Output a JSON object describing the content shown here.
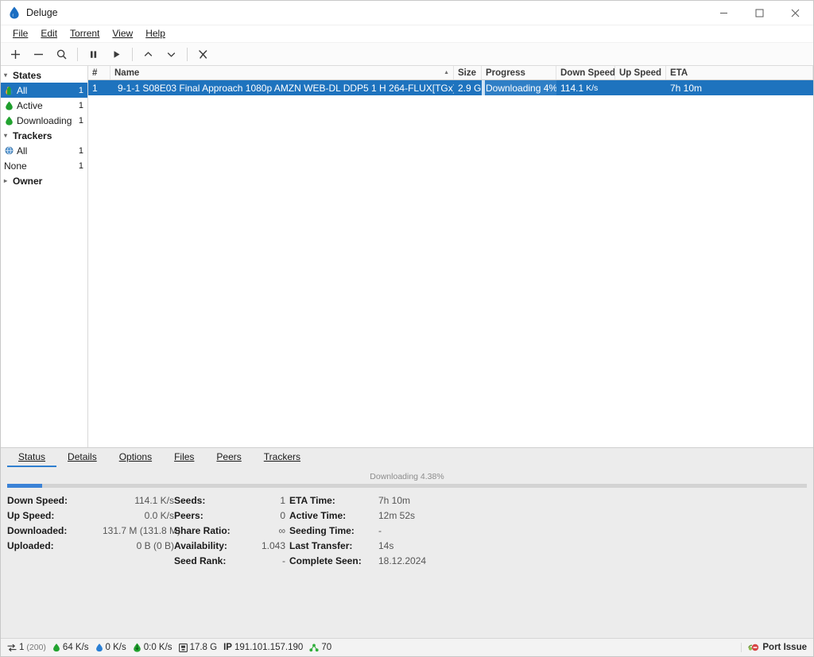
{
  "window": {
    "title": "Deluge",
    "icon": "deluge-droplet-icon",
    "minimize": "—",
    "maximize": "☐",
    "close": "✕"
  },
  "menubar": [
    {
      "label": "File",
      "accel": "F"
    },
    {
      "label": "Edit",
      "accel": "E"
    },
    {
      "label": "Torrent",
      "accel": "T"
    },
    {
      "label": "View",
      "accel": "V"
    },
    {
      "label": "Help",
      "accel": "H"
    }
  ],
  "toolbar": [
    {
      "name": "add-torrent-button",
      "icon": "plus-icon"
    },
    {
      "name": "remove-torrent-button",
      "icon": "minus-icon"
    },
    {
      "name": "search-button",
      "icon": "search-icon"
    },
    {
      "name": "pause-button",
      "icon": "pause-icon"
    },
    {
      "name": "resume-button",
      "icon": "play-icon"
    },
    {
      "name": "queue-up-button",
      "icon": "chevron-up-icon"
    },
    {
      "name": "queue-down-button",
      "icon": "chevron-down-icon"
    },
    {
      "name": "preferences-button",
      "icon": "wrench-icon"
    }
  ],
  "sidebar": {
    "groups": [
      {
        "label": "States",
        "expanded": true,
        "rows": [
          {
            "label": "All",
            "count": "1",
            "icon": "all-states-icon",
            "selected": true
          },
          {
            "label": "Active",
            "count": "1",
            "icon": "active-droplet-icon",
            "selected": false
          },
          {
            "label": "Downloading",
            "count": "1",
            "icon": "downloading-droplet-icon",
            "selected": false
          }
        ]
      },
      {
        "label": "Trackers",
        "expanded": true,
        "rows": [
          {
            "label": "All",
            "count": "1",
            "icon": "globe-icon",
            "selected": false
          },
          {
            "label": "None",
            "count": "1",
            "icon": "",
            "selected": false
          }
        ]
      },
      {
        "label": "Owner",
        "expanded": false,
        "rows": []
      }
    ]
  },
  "torrent_list": {
    "columns": [
      {
        "key": "num",
        "label": "#"
      },
      {
        "key": "name",
        "label": "Name",
        "sorted": true,
        "sort_dir": "asc"
      },
      {
        "key": "size",
        "label": "Size"
      },
      {
        "key": "progress",
        "label": "Progress"
      },
      {
        "key": "down_speed",
        "label": "Down Speed"
      },
      {
        "key": "up_speed",
        "label": "Up Speed"
      },
      {
        "key": "eta",
        "label": "ETA"
      }
    ],
    "rows": [
      {
        "num": "1",
        "icon": "downloading-droplet-icon",
        "name": "9-1-1 S08E03 Final Approach 1080p AMZN WEB-DL DDP5 1 H 264-FLUX[TGx]",
        "size": "2.9 G",
        "progress_label": "Downloading 4%",
        "progress_percent": 4,
        "down_speed": "114.1",
        "down_speed_unit": "K/s",
        "up_speed": "",
        "eta": "7h 10m",
        "selected": true
      }
    ]
  },
  "details": {
    "tabs": [
      {
        "label": "Status",
        "accel": "S",
        "active": true
      },
      {
        "label": "Details",
        "accel": "D",
        "active": false
      },
      {
        "label": "Options",
        "accel": "O",
        "active": false
      },
      {
        "label": "Files",
        "accel": "l",
        "active": false
      },
      {
        "label": "Peers",
        "accel": "P",
        "active": false
      },
      {
        "label": "Trackers",
        "accel": "T",
        "active": false
      }
    ],
    "progress": {
      "label": "Downloading 4.38%",
      "percent": 4.38
    },
    "columns": [
      {
        "name": "transfer-column",
        "rows": [
          {
            "key": "Down Speed:",
            "value": "114.1 K/s"
          },
          {
            "key": "Up Speed:",
            "value": "0.0 K/s"
          },
          {
            "key": "Downloaded:",
            "value": "131.7 M (131.8 M)"
          },
          {
            "key": "Uploaded:",
            "value": "0 B (0 B)"
          }
        ]
      },
      {
        "name": "swarm-column",
        "rows": [
          {
            "key": "Seeds:",
            "value": "1"
          },
          {
            "key": "Peers:",
            "value": "0"
          },
          {
            "key": "Share Ratio:",
            "value": "∞"
          },
          {
            "key": "Availability:",
            "value": "1.043"
          },
          {
            "key": "Seed Rank:",
            "value": "-"
          }
        ]
      },
      {
        "name": "time-column",
        "rows": [
          {
            "key": "ETA Time:",
            "value": "7h 10m"
          },
          {
            "key": "Active Time:",
            "value": "12m 52s"
          },
          {
            "key": "Seeding Time:",
            "value": "-"
          },
          {
            "key": "Last Transfer:",
            "value": "14s"
          },
          {
            "key": "Complete Seen:",
            "value": "18.12.2024"
          }
        ]
      }
    ]
  },
  "statusbar": {
    "items": [
      {
        "name": "connections",
        "icon": "connections-icon",
        "value": "1",
        "extra": "(200)"
      },
      {
        "name": "download-speed",
        "icon": "down-droplet-icon",
        "value": "64 K/s",
        "extra": ""
      },
      {
        "name": "upload-speed",
        "icon": "up-droplet-icon",
        "value": "0 K/s",
        "extra": ""
      },
      {
        "name": "protocol-traffic",
        "icon": "protocol-icon",
        "value": "0:0 K/s",
        "extra": ""
      },
      {
        "name": "free-space",
        "icon": "disk-icon",
        "value": "17.8 G",
        "extra": ""
      },
      {
        "name": "external-ip",
        "icon": "",
        "label": "IP",
        "value": "191.101.157.190",
        "extra": ""
      },
      {
        "name": "dht-nodes",
        "icon": "dht-icon",
        "value": "70",
        "extra": ""
      }
    ],
    "right": {
      "label": "Port Issue",
      "icon": "port-issue-icon"
    }
  },
  "colors": {
    "selection_blue": "#1e73be",
    "accent_blue": "#3b82d6",
    "droplet_green": "#22a330",
    "droplet_blue": "#2a7fd4",
    "warning_red": "#d64545"
  }
}
